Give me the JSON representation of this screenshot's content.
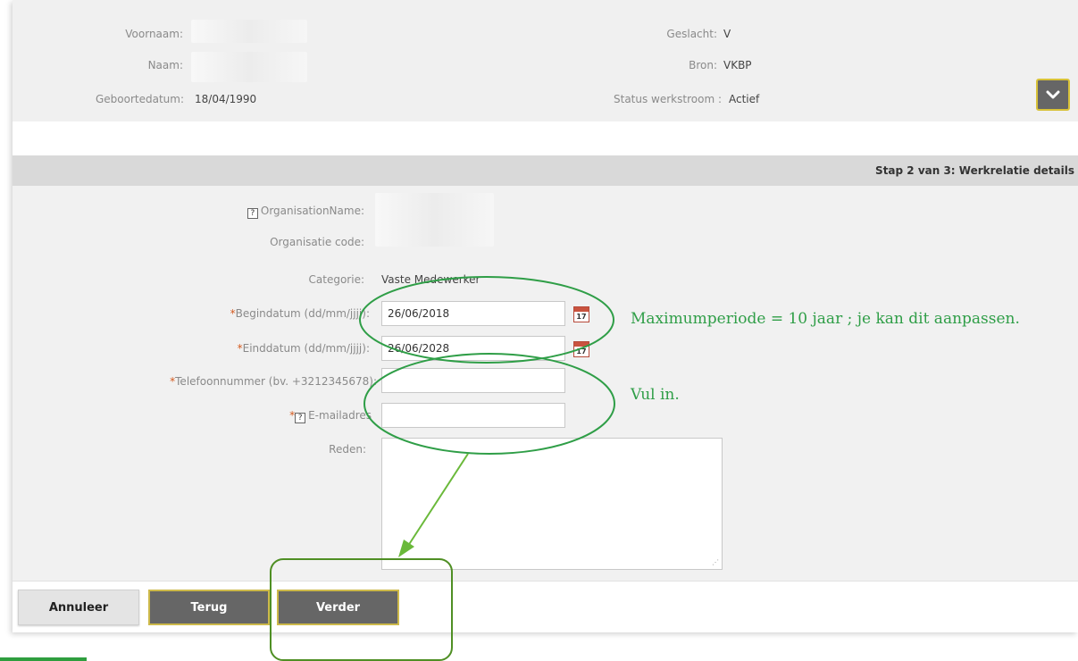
{
  "person": {
    "voornaam_label": "Voornaam:",
    "naam_label": "Naam:",
    "geboortedatum_label": "Geboortedatum:",
    "geboortedatum_value": "18/04/1990",
    "geslacht_label": "Geslacht:",
    "geslacht_value": "V",
    "bron_label": "Bron:",
    "bron_value": "VKBP",
    "status_label": "Status werkstroom :",
    "status_value": "Actief"
  },
  "step": {
    "title": "Stap 2 van 3: Werkrelatie details"
  },
  "form": {
    "org_name_label": "OrganisationName:",
    "org_code_label": "Organisatie code:",
    "categorie_label": "Categorie:",
    "categorie_value": "Vaste Medewerker",
    "begindatum_label": "Begindatum (dd/mm/jjjj):",
    "begindatum_value": "26/06/2018",
    "einddatum_label": "Einddatum (dd/mm/jjjj):",
    "einddatum_value": "26/06/2028",
    "telefoon_label": "Telefoonnummer (bv. +3212345678):",
    "telefoon_value": "",
    "email_label": "E-mailadres",
    "email_value": "",
    "reden_label": "Reden:",
    "reden_value": "",
    "calendar_day": "17",
    "required_mark": "*",
    "help_mark": "?"
  },
  "buttons": {
    "annuleer": "Annuleer",
    "terug": "Terug",
    "verder": "Verder"
  },
  "annotations": {
    "note_dates": "Maximumperiode = 10 jaar ; je kan dit aanpassen.",
    "note_fill": "Vul in.",
    "color": "#2f9e47"
  },
  "colors": {
    "button_dark": "#666666",
    "button_border": "#cdb94a",
    "required": "#d45a1f"
  }
}
